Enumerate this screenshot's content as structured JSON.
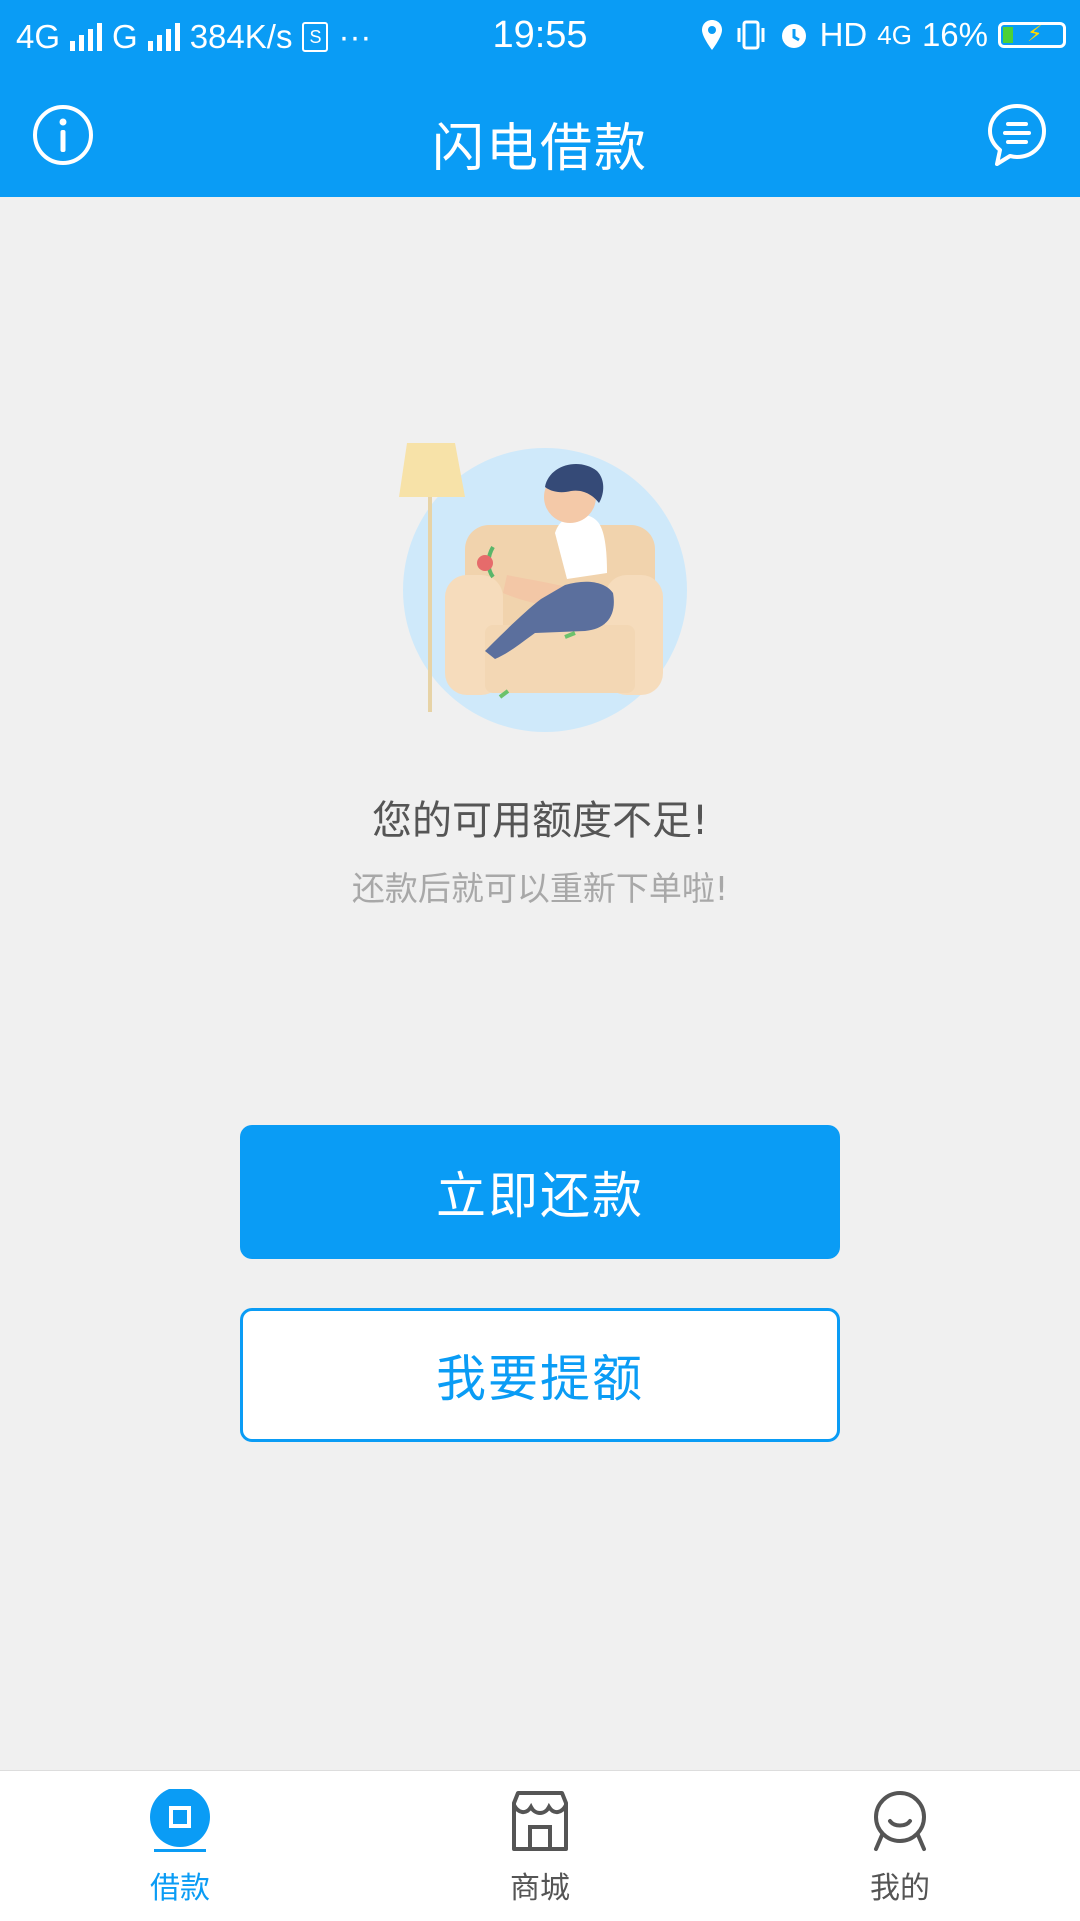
{
  "status_bar": {
    "network1": "4G",
    "network2": "G",
    "speed": "384K/s",
    "more": "···",
    "time": "19:55",
    "hd": "HD",
    "net4g": "4G",
    "battery": "16%"
  },
  "header": {
    "title": "闪电借款",
    "info_icon": "info-circle-icon",
    "chat_icon": "chat-bubble-icon"
  },
  "notice": {
    "title": "您的可用额度不足!",
    "subtitle": "还款后就可以重新下单啦!"
  },
  "actions": {
    "repay_label": "立即还款",
    "raise_limit_label": "我要提额"
  },
  "tabs": [
    {
      "label": "借款",
      "icon": "loan-icon",
      "active": true
    },
    {
      "label": "商城",
      "icon": "store-icon",
      "active": false
    },
    {
      "label": "我的",
      "icon": "profile-icon",
      "active": false
    }
  ],
  "colors": {
    "primary": "#0a9cf5",
    "background": "#f0f0f0"
  }
}
